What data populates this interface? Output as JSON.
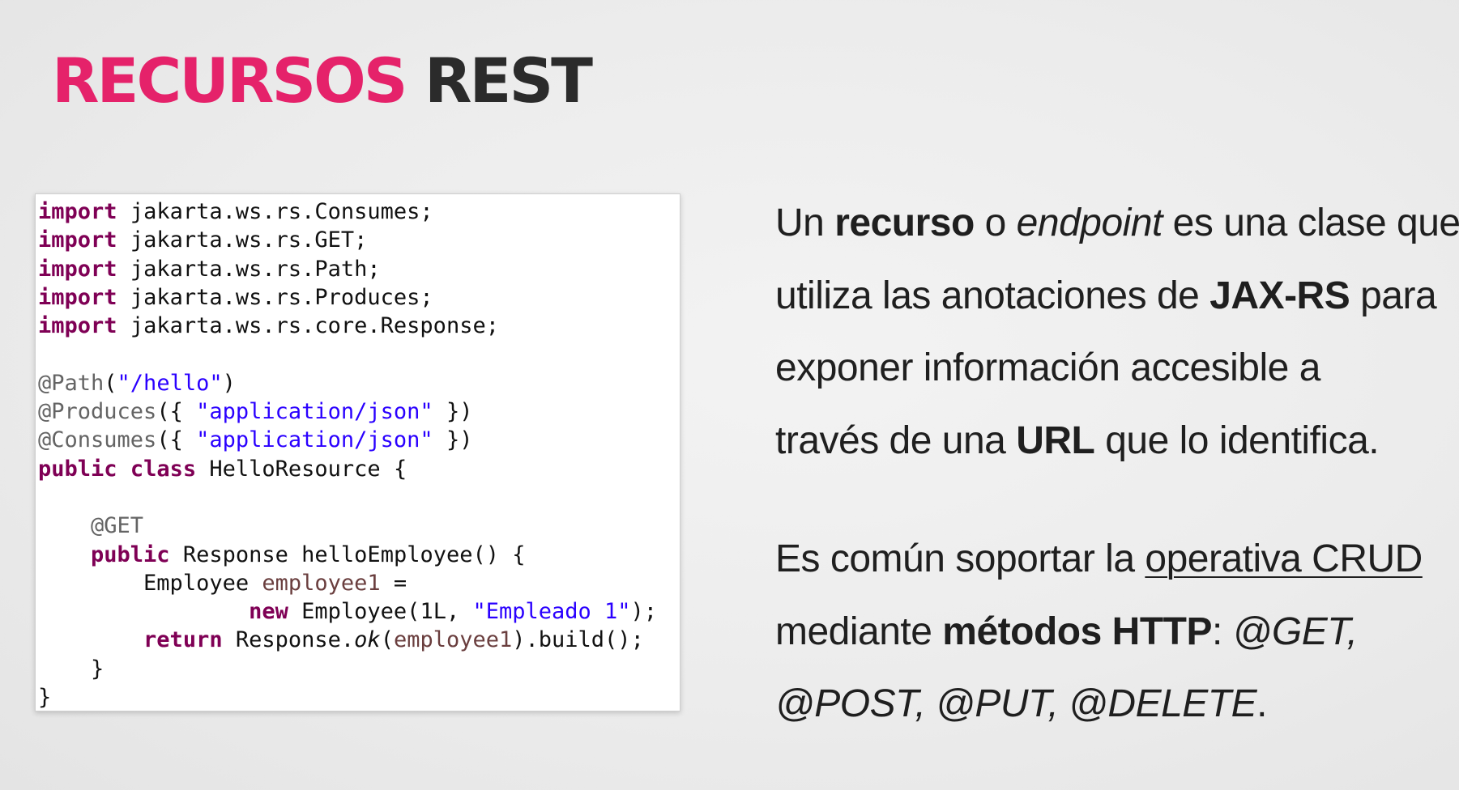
{
  "title": {
    "accent": "RECURSOS",
    "main": "REST"
  },
  "code": {
    "imports": [
      {
        "keyword": "import",
        "name": "jakarta.ws.rs.Consumes;"
      },
      {
        "keyword": "import",
        "name": "jakarta.ws.rs.GET;"
      },
      {
        "keyword": "import",
        "name": "jakarta.ws.rs.Path;"
      },
      {
        "keyword": "import",
        "name": "jakarta.ws.rs.Produces;"
      },
      {
        "keyword": "import",
        "name": "jakarta.ws.rs.core.Response;"
      }
    ],
    "path_annotation": "@Path",
    "path_value": "\"/hello\"",
    "produces_annotation": "@Produces",
    "consumes_annotation": "@Consumes",
    "media_type": "\"application/json\"",
    "kw_public": "public",
    "kw_class": "class",
    "class_name": "HelloResource",
    "get_annotation": "@GET",
    "return_type": "Response",
    "method_name": "helloEmployee",
    "local_type": "Employee",
    "local_var": "employee1",
    "kw_new": "new",
    "constructor_call": "Employee(1L, ",
    "constructor_arg": "\"Empleado 1\"",
    "kw_return": "return",
    "response_class": "Response.",
    "ok_method": "ok",
    "build_call": ").build();"
  },
  "description": {
    "p1": {
      "line1": {
        "t1": "Un ",
        "b1": "recurso",
        "t2": " o ",
        "i1": "endpoint",
        "t3": " es una clase que"
      },
      "line2": {
        "t1": "utiliza las anotaciones de ",
        "b1": "JAX-RS",
        "t2": " para"
      },
      "line3": {
        "t1": "exponer información accesible a"
      },
      "line4": {
        "t1": "través de una ",
        "b1": "URL",
        "t2": " que lo identifica."
      }
    },
    "p2": {
      "line1": {
        "t1": "Es común soportar la ",
        "u1": "operativa CRUD"
      },
      "line2": {
        "t1": "mediante ",
        "b1": "métodos HTTP",
        "t2": ": ",
        "i1": "@GET,"
      },
      "line3": {
        "i1": "@POST, @PUT, @DELETE",
        "t1": "."
      }
    }
  }
}
